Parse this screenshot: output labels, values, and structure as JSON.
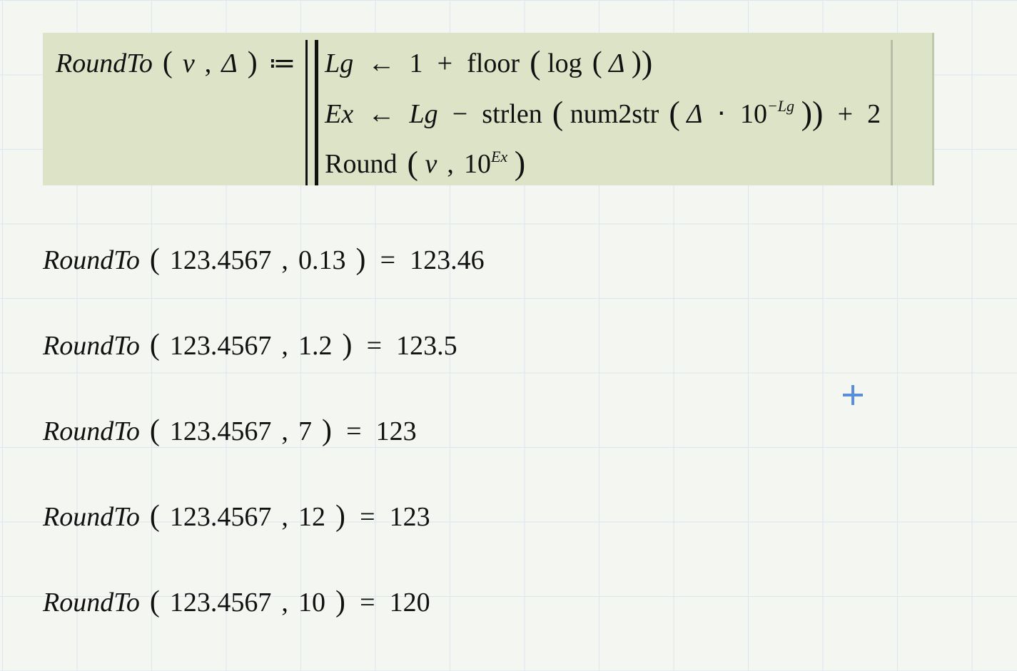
{
  "definition": {
    "fnName": "RoundTo",
    "params": {
      "v": "v",
      "delta": "Δ"
    },
    "assignOp": "≔",
    "lines": {
      "l1": {
        "var": "Lg",
        "arrow": "←",
        "one": "1",
        "plus": "+",
        "floor": "floor",
        "log": "log"
      },
      "l2": {
        "var": "Ex",
        "arrow": "←",
        "Lg": "Lg",
        "minus": "−",
        "strlen": "strlen",
        "num2str": "num2str",
        "dot": "⋅",
        "ten": "10",
        "negLgExp": "−Lg",
        "plus": "+",
        "two": "2"
      },
      "l3": {
        "round": "Round",
        "ten": "10",
        "ExExp": "Ex"
      }
    }
  },
  "examples": [
    {
      "fn": "RoundTo",
      "arg1": "123.4567",
      "arg2": "0.13",
      "eq": "=",
      "result": "123.46"
    },
    {
      "fn": "RoundTo",
      "arg1": "123.4567",
      "arg2": "1.2",
      "eq": "=",
      "result": "123.5"
    },
    {
      "fn": "RoundTo",
      "arg1": "123.4567",
      "arg2": "7",
      "eq": "=",
      "result": "123"
    },
    {
      "fn": "RoundTo",
      "arg1": "123.4567",
      "arg2": "12",
      "eq": "=",
      "result": "123"
    },
    {
      "fn": "RoundTo",
      "arg1": "123.4567",
      "arg2": "10",
      "eq": "=",
      "result": "120"
    }
  ],
  "common": {
    "comma": ","
  }
}
